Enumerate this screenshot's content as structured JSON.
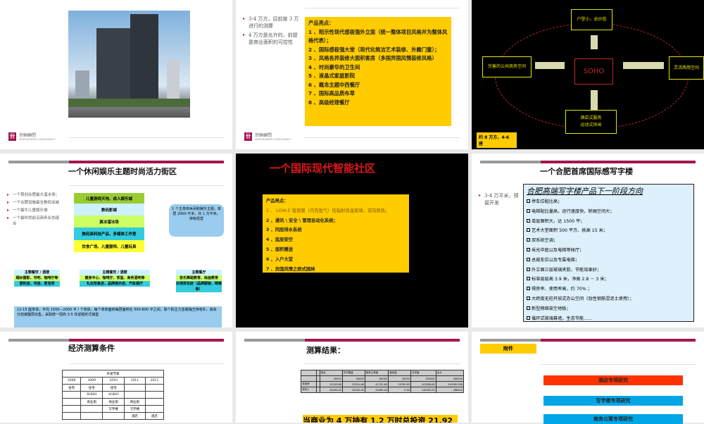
{
  "logo": {
    "cn": "世聯顧問",
    "en": "WORLDUNION CONSULTANCY"
  },
  "slide2": {
    "bullets": [
      "3-4 万方，目前按 3 万进行的测算",
      "4 万方是允许的，前提是商业面积的可控性"
    ],
    "box_title": "产品亮点：",
    "items": [
      "1 、昭示性现代感极强外立面（统一整体项目风格并为整体风格代表）；",
      "2 、国际感极强大堂（现代化简洁艺术装修、外籍门童）；",
      "3 、风格各异装修大面积客房（多国异国风情装修风格）",
      "4 、时尚豪华的卫生间",
      "5 、液晶式家庭影院",
      "6 、概念主题中西餐厅",
      "7 、国际高品质布草",
      "8 、高级经理餐厅"
    ]
  },
  "slide3": {
    "center": "SOHO",
    "top": "户型小，总价低",
    "left": "完善的公共商务空间",
    "right": "灵活两用空间",
    "bottom": [
      "酒店式服务",
      "运动式休闲"
    ],
    "label": "约 8 万方，4-6 座"
  },
  "slide4": {
    "title": "一个休闲娱乐主题时尚活力街区",
    "bullets": [
      "一个首创合肥最大溜冰场；",
      "一个合肥设施最全数码泳城",
      "一个最牛儿童娱乐城",
      "一个最时尚前沿商务业态组合"
    ],
    "layers": [
      "儿童游戏天地、成人娱乐城",
      "数码影城",
      "真冰溜冰场",
      "数码高科技产品、多媒体工作室",
      "饮食广场、儿童服饰、儿童玩具"
    ],
    "callout": "1 个主单体休闲和娱乐主题，单层 2000 平米，共 1 万平米，持有经营",
    "blocks": [
      {
        "head": "主题餐饮 / 酒楼",
        "r1": "婚纱摄影、书吧、咖啡厅等",
        "r2": "便利店、书店、麦当劳"
      },
      {
        "head": "主题餐饮 / 酒楼",
        "r1": "健身中心、咖啡厅、茶室、商务酒吧等",
        "r2": "礼仪形象店、品牌展示店、汽车展厅"
      },
      {
        "head": "主题餐厅",
        "r1": "音乐舞蹈教育、绘画教育",
        "r2": "白领折扣店（品牌服装、眼镜等）"
      }
    ],
    "banner": "12-15 座单体，平均 1500—2000 平 / 个单体，每个单体面积每层面积在 500-800 平之间，除个别主力店或铺王持有外，其余分割或整层出售，采取统一招商 3-5 年返租形式销售"
  },
  "slide5": {
    "title": "一个国际现代智能社区",
    "box_title": "产品亮点：",
    "items": [
      "1 、 LOW-E 镀银膜（内充氩气）低辐射保温玻璃，双向阻热；",
      "2 、通讯 \\ 安全 \\ 管理自动化系统；",
      "3 、同层排水系统",
      "4 、底层架空",
      "5 、面积赠送",
      "6 、入户大堂",
      "7 、异国风情之欧式园林"
    ]
  },
  "slide6": {
    "title": "一个合肥首席国际感写字楼",
    "bullet": "3-4 万平米，预留开发",
    "box_title": "合肥高端写字楼产品下一阶段方向",
    "items": [
      "停车位配比高；",
      "电梯配比量高，运行速度快，轿厢空间大；",
      "单层面积大，达 1500 平；",
      "艺术大堂面积 500 平方、挑高 15 米；",
      "双系统空调；",
      "采光中庭以及电梯等候厅；",
      "总裁车位以及专属电梯；",
      "外立面三层玻璃夹胶，节能效果好；",
      "标准层层高 3.9 米，净高 2.8 － 3 米；",
      "得房率、使用率高，约 70% ；",
      "大跨度无柱开放式办公空间（劲性钢筋混泥土使用）；",
      "新型网络架空地板；",
      "循环式玻璃幕墙，生态节能……"
    ]
  },
  "slide7": {
    "title": "经济测算条件",
    "table_head": "开发节奏",
    "rows": [
      [
        "2008",
        "2009",
        "2010",
        "2011",
        "2012"
      ],
      [
        "住宅",
        "住宅",
        "住宅",
        "",
        ""
      ],
      [
        "",
        "SOHO",
        "SOHO",
        "",
        ""
      ],
      [
        "",
        "商业街",
        "商业街",
        "商业街",
        ""
      ],
      [
        "",
        "",
        "写字楼",
        "写字楼",
        ""
      ],
      [
        "",
        "",
        "",
        "酒店",
        "酒店"
      ]
    ]
  },
  "slide8": {
    "title": "测算结果：",
    "rows": [
      [
        "",
        "",
        "商业",
        "写字楼量",
        "商务公寓量",
        "酒店量",
        "住宅量",
        "合计"
      ],
      [
        "",
        "",
        "40000",
        "40000",
        "80000",
        "40000",
        "200000",
        "400000"
      ],
      [
        "总投资",
        "",
        "21345.68",
        "23591.68",
        "41725.60",
        "29765.65",
        "102856.80",
        "219285.008"
      ],
      [
        "总收入",
        "",
        "42000.00",
        "32000.00",
        "54400.00",
        "0.00",
        "140000.00",
        "268400"
      ]
    ],
    "summary": "当商业为 4 万持有 1.2 万时总投资 21.92"
  },
  "slide9": {
    "tag": "附件",
    "links": [
      "酒店专项研究",
      "写字楼专项研究",
      "商务公寓专项研究"
    ]
  },
  "colors": {
    "accent": "#a3164f",
    "yellow": "#ffcc00",
    "red": "#ff3300",
    "blue": "#00a6e6"
  }
}
